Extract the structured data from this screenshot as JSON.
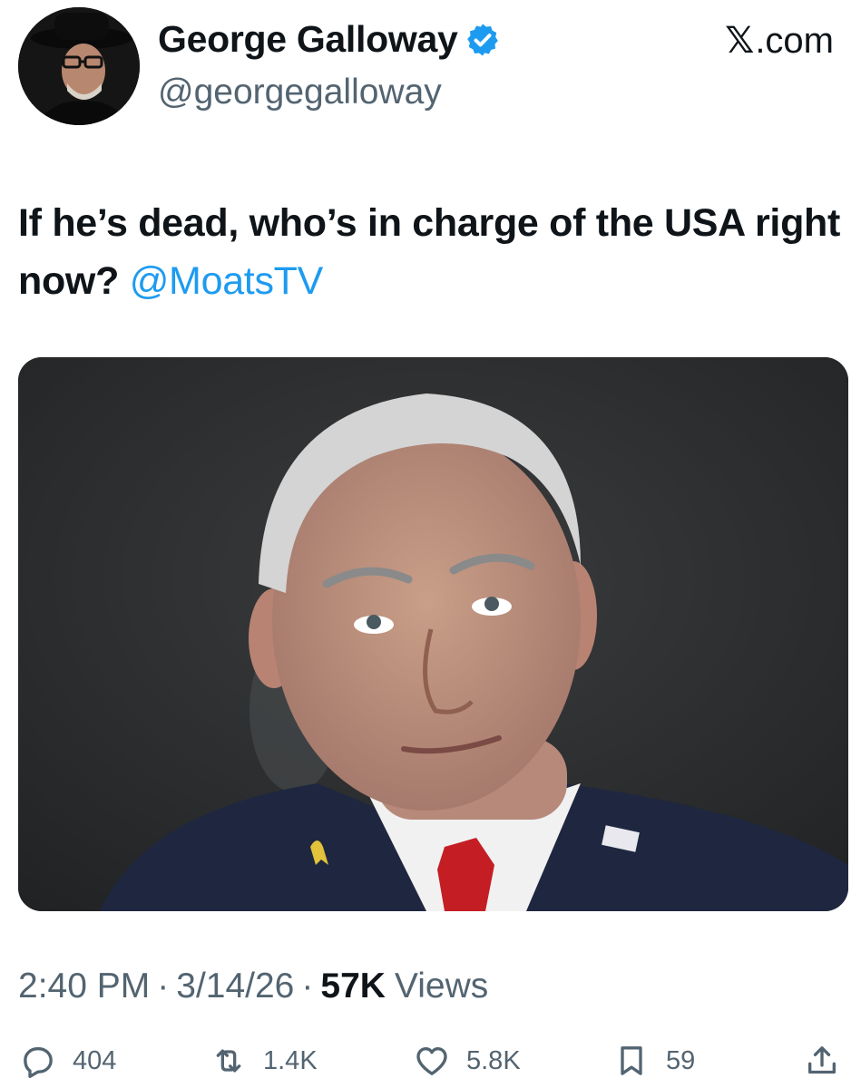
{
  "header": {
    "display_name": "George Galloway",
    "handle": "@georgegalloway",
    "verified": true,
    "brand": "X.com",
    "brand_x": "𝕏",
    "brand_domain": ".com"
  },
  "tweet": {
    "text": "If he’s dead, who’s in charge of the USA right now?",
    "mention": "@MoatsTV"
  },
  "meta": {
    "time": "2:40 PM",
    "separator": "·",
    "date": "3/14/26",
    "views_count": "57K",
    "views_label": "Views"
  },
  "actions": {
    "replies": "404",
    "reposts": "1.4K",
    "likes": "5.8K",
    "bookmarks": "59"
  },
  "icons": {
    "verified": "verified-badge-icon",
    "reply": "reply-icon",
    "repost": "repost-icon",
    "like": "heart-icon",
    "bookmark": "bookmark-icon",
    "share": "share-icon"
  },
  "colors": {
    "accent": "#1d9bf0",
    "text_primary": "#0f1419",
    "text_secondary": "#536471"
  }
}
